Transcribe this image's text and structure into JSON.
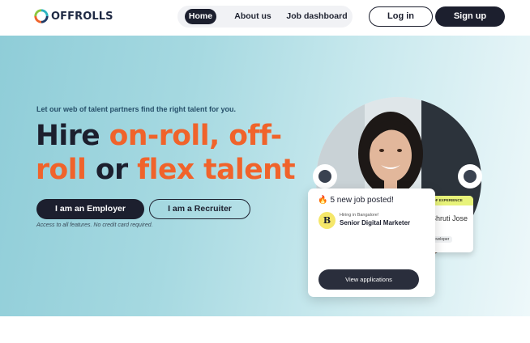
{
  "header": {
    "logo_text": "OFFROLLS",
    "nav": [
      {
        "label": "Home",
        "active": true
      },
      {
        "label": "About us",
        "active": false
      },
      {
        "label": "Job dashboard",
        "active": false
      }
    ],
    "login_label": "Log in",
    "signup_label": "Sign up"
  },
  "hero": {
    "tagline": "Let our web of talent partners find the right talent for you.",
    "headline": {
      "part1": "Hire ",
      "part2": "on-roll, off-roll",
      "part3": " or ",
      "part4": "flex talent"
    },
    "employer_button": "I am an Employer",
    "recruiter_button": "I am a Recruiter",
    "fineprint": "Access to all features. No credit card required."
  },
  "profile_card": {
    "banner": "8+ YEARS OF EXPERIENCE",
    "name": "Shruti Jose",
    "role": "ck developer"
  },
  "job_card": {
    "count_text": "5 new job posted!",
    "company_initial": "B",
    "location": "Hiring in Bangalore!",
    "title": "Senior Digital Marketer",
    "view_button": "View applications"
  },
  "colors": {
    "brand_dark": "#1c1f2e",
    "accent_orange": "#f0632b",
    "hero_teal": "#8fcdd8"
  }
}
